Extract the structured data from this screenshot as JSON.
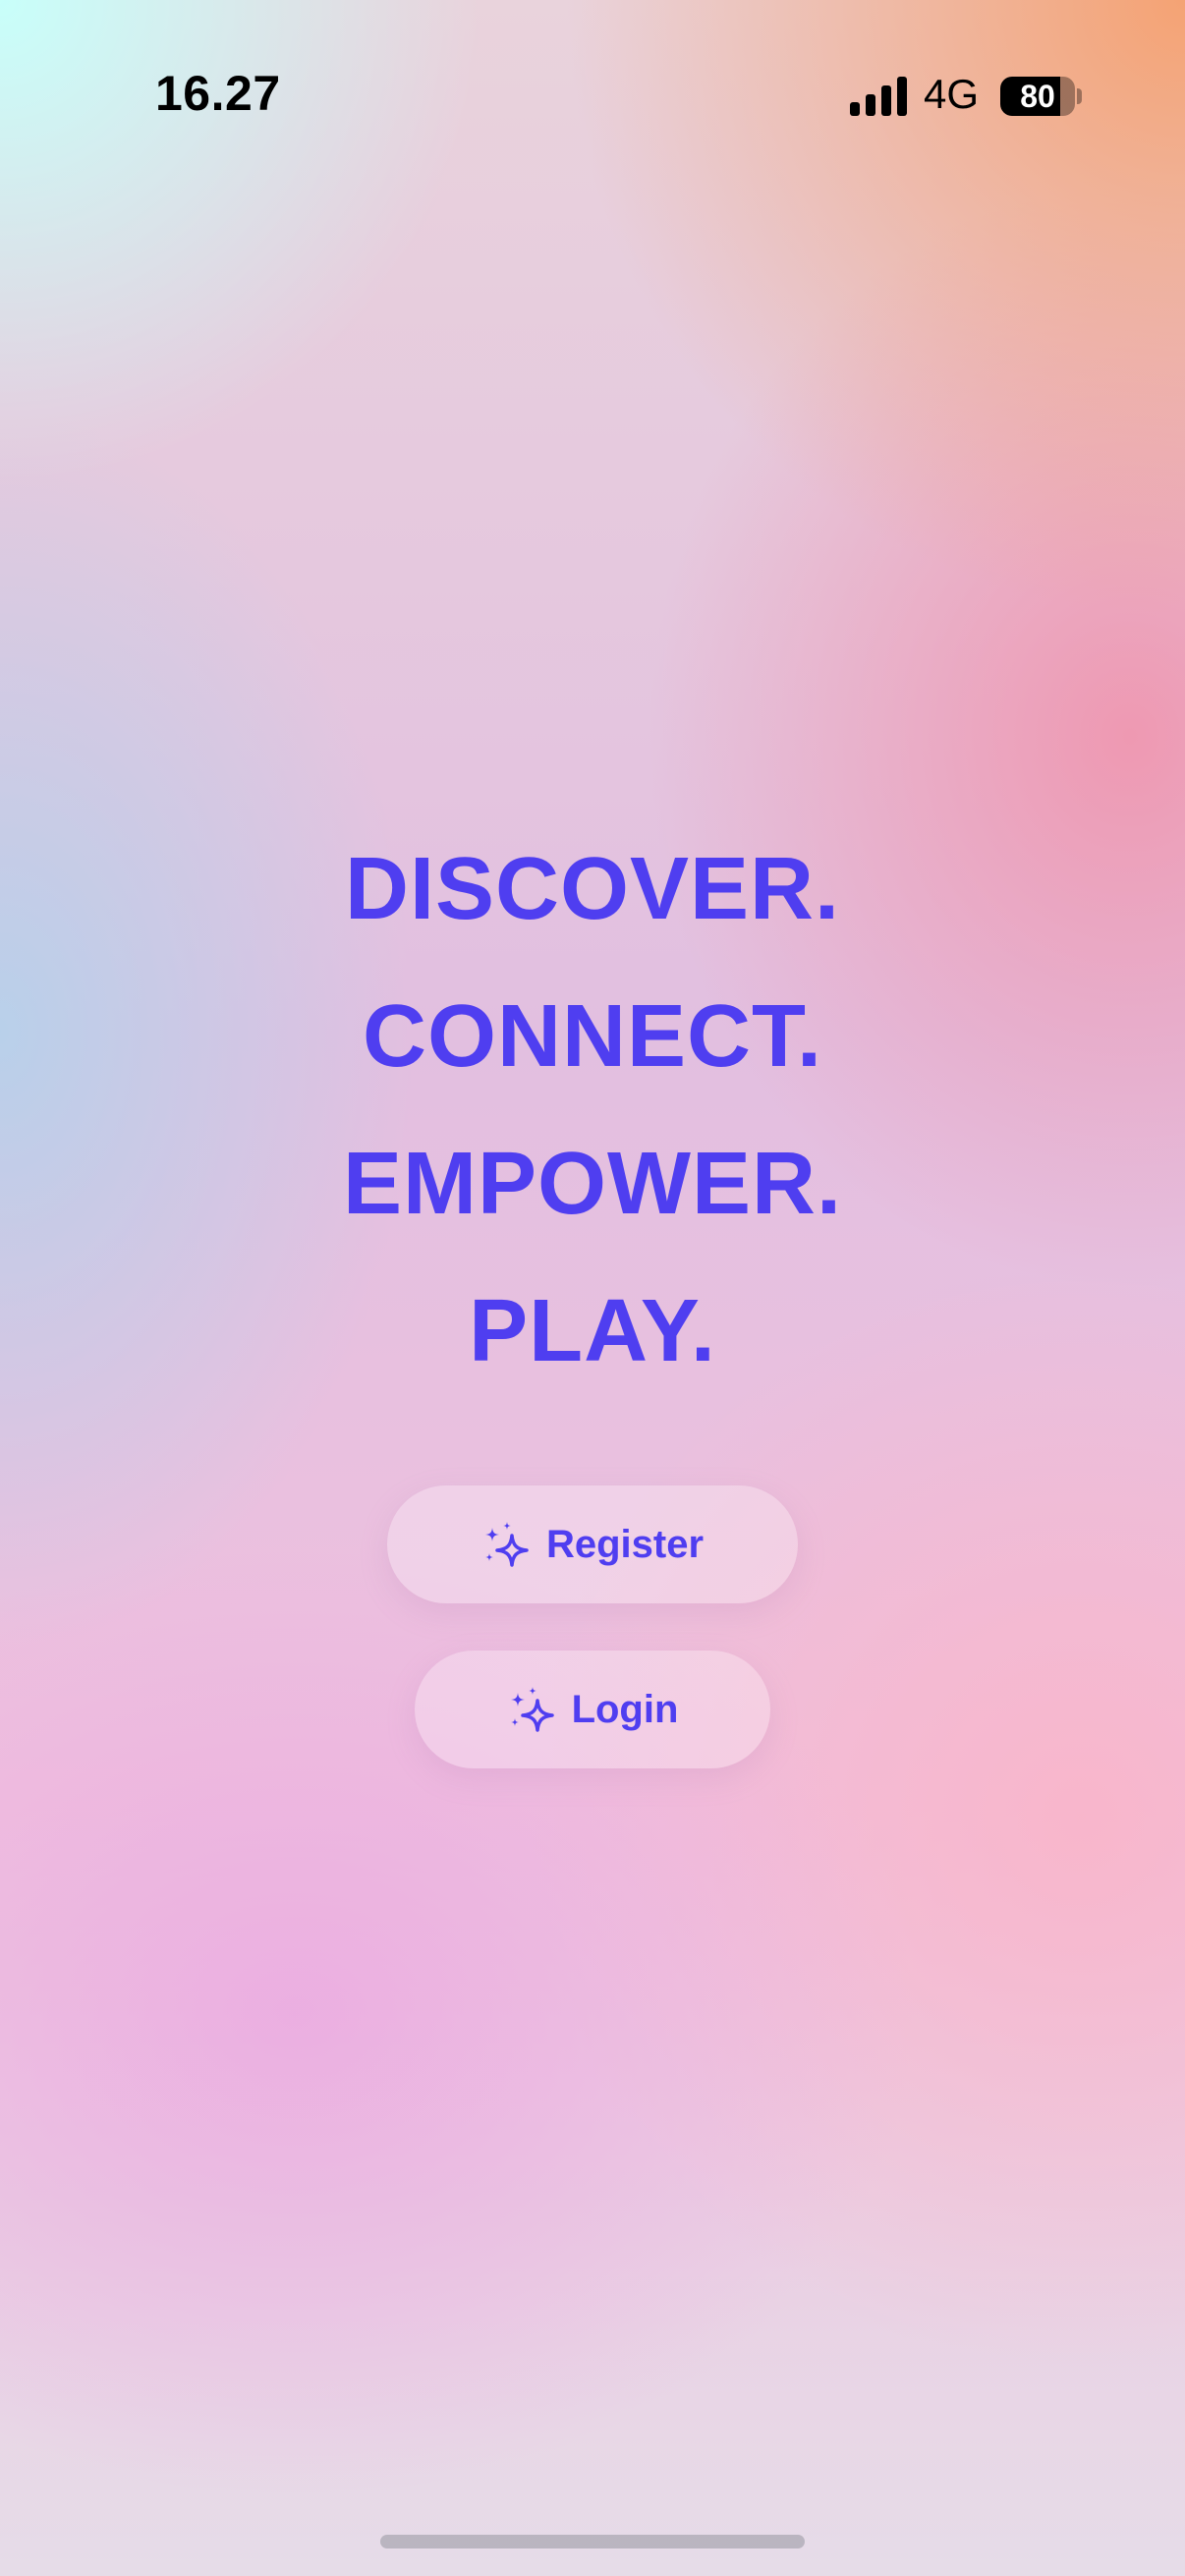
{
  "status_bar": {
    "time": "16.27",
    "network": "4G",
    "battery": "80",
    "signal_icon": "cellular-signal-icon"
  },
  "headline": {
    "lines": [
      "DISCOVER.",
      "CONNECT.",
      "EMPOWER.",
      "PLAY."
    ]
  },
  "buttons": {
    "register_label": "Register",
    "login_label": "Login",
    "icon": "sparkles-icon"
  },
  "colors": {
    "accent": "#4f3ef0"
  }
}
